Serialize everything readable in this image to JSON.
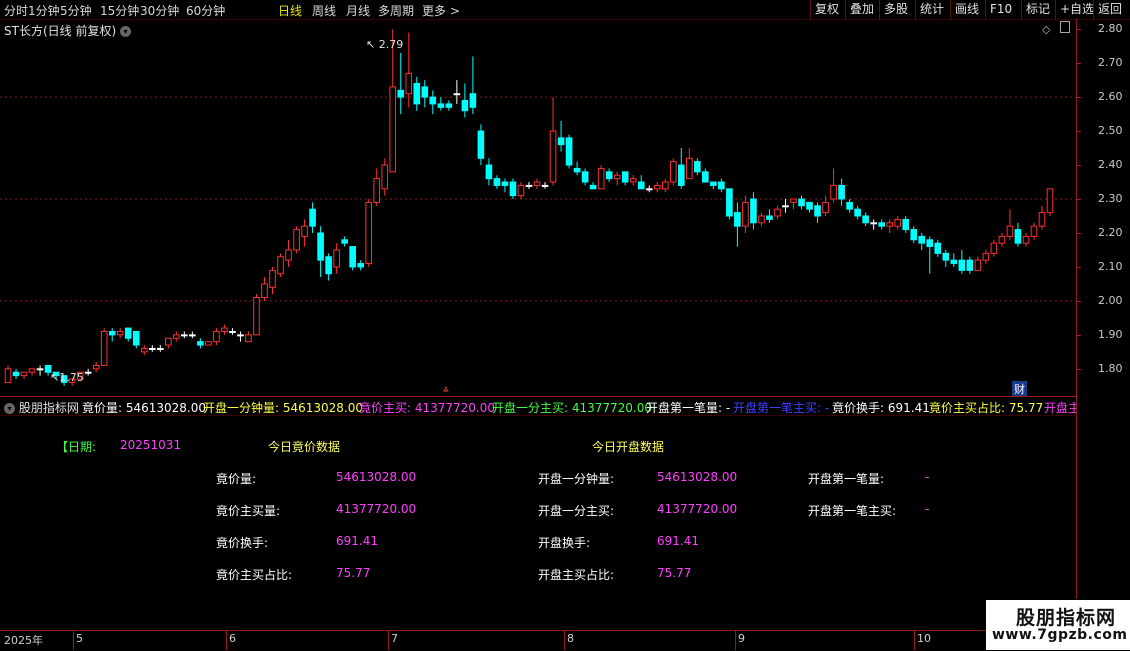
{
  "toolbar": {
    "periods": [
      {
        "label": "分时",
        "active": false
      },
      {
        "label": "1分钟",
        "active": false
      },
      {
        "label": "5分钟",
        "active": false
      },
      {
        "label": "15分钟",
        "active": false
      },
      {
        "label": "30分钟",
        "active": false
      },
      {
        "label": "60分钟",
        "active": false
      },
      {
        "label": "日线",
        "active": true
      },
      {
        "label": "周线",
        "active": false
      },
      {
        "label": "月线",
        "active": false
      },
      {
        "label": "多周期",
        "active": false
      },
      {
        "label": "更多 >",
        "active": false
      }
    ],
    "right_buttons": [
      "复权",
      "叠加",
      "多股",
      "统计",
      "画线",
      "F10",
      "标记",
      "+自选",
      "返回"
    ]
  },
  "chart": {
    "stock_title": "ST长方(日线 前复权)",
    "high_label": "2.79",
    "low_label": "1.75",
    "y_ticks": [
      "2.80",
      "2.70",
      "2.60",
      "2.50",
      "2.40",
      "2.30",
      "2.20",
      "2.10",
      "2.00",
      "1.90",
      "1.80"
    ],
    "fin_badge": "财",
    "colors": {
      "up": "#ff3030",
      "down": "#00ffff",
      "flat": "#ffffff",
      "grid": "#8b1a1a"
    }
  },
  "indicator_strip": {
    "name": "股朋指标网",
    "items": [
      {
        "text": "竟价量: 54613028.00",
        "color": "#ffffff"
      },
      {
        "text": "开盘一分钟量: 54613028.00",
        "color": "#ffff40"
      },
      {
        "text": "竟价主买: 41377720.00",
        "color": "#ff40ff"
      },
      {
        "text": "开盘一分主买: 41377720.00",
        "color": "#40ff40"
      },
      {
        "text": "开盘第一笔量: -",
        "color": "#ffffff"
      },
      {
        "text": "开盘第一笔主买: -",
        "color": "#4040ff"
      },
      {
        "text": "竟价换手: 691.41",
        "color": "#ffffff"
      },
      {
        "text": "竟价主买占比: 75.77",
        "color": "#ffff40"
      },
      {
        "text": "开盘主",
        "color": "#ff40ff"
      }
    ]
  },
  "table": {
    "date_label": "【日期:",
    "date_value": "20251031",
    "left_header": "今日竟价数据",
    "right_header": "今日开盘数据",
    "left_rows": [
      {
        "label": "竟价量:",
        "value": "54613028.00"
      },
      {
        "label": "竟价主买量:",
        "value": "41377720.00"
      },
      {
        "label": "竟价换手:",
        "value": "691.41"
      },
      {
        "label": "竟价主买占比:",
        "value": "75.77"
      }
    ],
    "mid_rows": [
      {
        "label": "开盘一分钟量:",
        "value": "54613028.00"
      },
      {
        "label": "开盘一分主买:",
        "value": "41377720.00"
      },
      {
        "label": "开盘换手:",
        "value": "691.41"
      },
      {
        "label": "开盘主买占比:",
        "value": "75.77"
      }
    ],
    "right_rows": [
      {
        "label": "开盘第一笔量:",
        "value": "-"
      },
      {
        "label": "开盘第一笔主买:",
        "value": "-"
      }
    ]
  },
  "date_axis": {
    "labels": [
      "2025年",
      "5",
      "6",
      "7",
      "8",
      "9",
      "10"
    ]
  },
  "watermark": {
    "title": "股朋指标网",
    "url": "www.7gpzb.com"
  },
  "chart_data": {
    "type": "candlestick",
    "y_range": [
      1.72,
      2.83
    ],
    "candles": [
      {
        "o": 1.76,
        "h": 1.81,
        "l": 1.76,
        "c": 1.8
      },
      {
        "o": 1.79,
        "h": 1.8,
        "l": 1.77,
        "c": 1.78
      },
      {
        "o": 1.78,
        "h": 1.79,
        "l": 1.77,
        "c": 1.79
      },
      {
        "o": 1.79,
        "h": 1.8,
        "l": 1.78,
        "c": 1.8
      },
      {
        "o": 1.8,
        "h": 1.81,
        "l": 1.78,
        "c": 1.8
      },
      {
        "o": 1.81,
        "h": 1.81,
        "l": 1.78,
        "c": 1.79
      },
      {
        "o": 1.79,
        "h": 1.79,
        "l": 1.77,
        "c": 1.78
      },
      {
        "o": 1.78,
        "h": 1.78,
        "l": 1.75,
        "c": 1.76
      },
      {
        "o": 1.76,
        "h": 1.77,
        "l": 1.75,
        "c": 1.77
      },
      {
        "o": 1.77,
        "h": 1.79,
        "l": 1.77,
        "c": 1.79
      },
      {
        "o": 1.79,
        "h": 1.8,
        "l": 1.78,
        "c": 1.79
      },
      {
        "o": 1.8,
        "h": 1.82,
        "l": 1.79,
        "c": 1.81
      },
      {
        "o": 1.81,
        "h": 1.92,
        "l": 1.81,
        "c": 1.91
      },
      {
        "o": 1.91,
        "h": 1.92,
        "l": 1.88,
        "c": 1.9
      },
      {
        "o": 1.9,
        "h": 1.92,
        "l": 1.89,
        "c": 1.91
      },
      {
        "o": 1.92,
        "h": 1.92,
        "l": 1.88,
        "c": 1.89
      },
      {
        "o": 1.91,
        "h": 1.91,
        "l": 1.86,
        "c": 1.87
      },
      {
        "o": 1.85,
        "h": 1.87,
        "l": 1.84,
        "c": 1.86
      },
      {
        "o": 1.86,
        "h": 1.87,
        "l": 1.85,
        "c": 1.86
      },
      {
        "o": 1.86,
        "h": 1.87,
        "l": 1.85,
        "c": 1.86
      },
      {
        "o": 1.87,
        "h": 1.89,
        "l": 1.86,
        "c": 1.89
      },
      {
        "o": 1.89,
        "h": 1.91,
        "l": 1.88,
        "c": 1.9
      },
      {
        "o": 1.9,
        "h": 1.91,
        "l": 1.89,
        "c": 1.9
      },
      {
        "o": 1.9,
        "h": 1.91,
        "l": 1.89,
        "c": 1.9
      },
      {
        "o": 1.88,
        "h": 1.89,
        "l": 1.86,
        "c": 1.87
      },
      {
        "o": 1.87,
        "h": 1.88,
        "l": 1.87,
        "c": 1.88
      },
      {
        "o": 1.88,
        "h": 1.92,
        "l": 1.87,
        "c": 1.91
      },
      {
        "o": 1.91,
        "h": 1.93,
        "l": 1.9,
        "c": 1.92
      },
      {
        "o": 1.91,
        "h": 1.92,
        "l": 1.9,
        "c": 1.91
      },
      {
        "o": 1.9,
        "h": 1.91,
        "l": 1.88,
        "c": 1.9
      },
      {
        "o": 1.88,
        "h": 1.91,
        "l": 1.88,
        "c": 1.9
      },
      {
        "o": 1.9,
        "h": 2.02,
        "l": 1.9,
        "c": 2.01
      },
      {
        "o": 2.01,
        "h": 2.07,
        "l": 2.0,
        "c": 2.05
      },
      {
        "o": 2.04,
        "h": 2.1,
        "l": 2.02,
        "c": 2.09
      },
      {
        "o": 2.08,
        "h": 2.14,
        "l": 2.07,
        "c": 2.13
      },
      {
        "o": 2.12,
        "h": 2.18,
        "l": 2.1,
        "c": 2.15
      },
      {
        "o": 2.15,
        "h": 2.22,
        "l": 2.14,
        "c": 2.21
      },
      {
        "o": 2.19,
        "h": 2.24,
        "l": 2.16,
        "c": 2.22
      },
      {
        "o": 2.27,
        "h": 2.29,
        "l": 2.2,
        "c": 2.22
      },
      {
        "o": 2.2,
        "h": 2.22,
        "l": 2.07,
        "c": 2.12
      },
      {
        "o": 2.13,
        "h": 2.14,
        "l": 2.06,
        "c": 2.08
      },
      {
        "o": 2.1,
        "h": 2.17,
        "l": 2.08,
        "c": 2.15
      },
      {
        "o": 2.18,
        "h": 2.19,
        "l": 2.16,
        "c": 2.17
      },
      {
        "o": 2.16,
        "h": 2.16,
        "l": 2.09,
        "c": 2.1
      },
      {
        "o": 2.11,
        "h": 2.12,
        "l": 2.09,
        "c": 2.1
      },
      {
        "o": 2.11,
        "h": 2.3,
        "l": 2.1,
        "c": 2.29
      },
      {
        "o": 2.29,
        "h": 2.39,
        "l": 2.28,
        "c": 2.36
      },
      {
        "o": 2.33,
        "h": 2.42,
        "l": 2.31,
        "c": 2.4
      },
      {
        "o": 2.38,
        "h": 2.8,
        "l": 2.38,
        "c": 2.63
      },
      {
        "o": 2.62,
        "h": 2.73,
        "l": 2.55,
        "c": 2.6
      },
      {
        "o": 2.61,
        "h": 2.79,
        "l": 2.57,
        "c": 2.67
      },
      {
        "o": 2.64,
        "h": 2.66,
        "l": 2.56,
        "c": 2.58
      },
      {
        "o": 2.63,
        "h": 2.65,
        "l": 2.57,
        "c": 2.6
      },
      {
        "o": 2.6,
        "h": 2.62,
        "l": 2.55,
        "c": 2.58
      },
      {
        "o": 2.58,
        "h": 2.6,
        "l": 2.56,
        "c": 2.57
      },
      {
        "o": 2.58,
        "h": 2.59,
        "l": 2.56,
        "c": 2.57
      },
      {
        "o": 2.61,
        "h": 2.65,
        "l": 2.58,
        "c": 2.61
      },
      {
        "o": 2.59,
        "h": 2.64,
        "l": 2.54,
        "c": 2.56
      },
      {
        "o": 2.61,
        "h": 2.72,
        "l": 2.55,
        "c": 2.57
      },
      {
        "o": 2.5,
        "h": 2.52,
        "l": 2.4,
        "c": 2.42
      },
      {
        "o": 2.4,
        "h": 2.42,
        "l": 2.34,
        "c": 2.36
      },
      {
        "o": 2.36,
        "h": 2.37,
        "l": 2.33,
        "c": 2.34
      },
      {
        "o": 2.35,
        "h": 2.36,
        "l": 2.32,
        "c": 2.34
      },
      {
        "o": 2.35,
        "h": 2.36,
        "l": 2.3,
        "c": 2.31
      },
      {
        "o": 2.31,
        "h": 2.35,
        "l": 2.3,
        "c": 2.34
      },
      {
        "o": 2.34,
        "h": 2.35,
        "l": 2.33,
        "c": 2.34
      },
      {
        "o": 2.34,
        "h": 2.36,
        "l": 2.33,
        "c": 2.35
      },
      {
        "o": 2.34,
        "h": 2.35,
        "l": 2.33,
        "c": 2.34
      },
      {
        "o": 2.35,
        "h": 2.6,
        "l": 2.34,
        "c": 2.5
      },
      {
        "o": 2.48,
        "h": 2.53,
        "l": 2.44,
        "c": 2.46
      },
      {
        "o": 2.48,
        "h": 2.49,
        "l": 2.39,
        "c": 2.4
      },
      {
        "o": 2.39,
        "h": 2.41,
        "l": 2.37,
        "c": 2.38
      },
      {
        "o": 2.38,
        "h": 2.39,
        "l": 2.34,
        "c": 2.35
      },
      {
        "o": 2.34,
        "h": 2.35,
        "l": 2.33,
        "c": 2.33
      },
      {
        "o": 2.33,
        "h": 2.4,
        "l": 2.33,
        "c": 2.39
      },
      {
        "o": 2.38,
        "h": 2.39,
        "l": 2.35,
        "c": 2.36
      },
      {
        "o": 2.36,
        "h": 2.38,
        "l": 2.34,
        "c": 2.37
      },
      {
        "o": 2.38,
        "h": 2.38,
        "l": 2.34,
        "c": 2.35
      },
      {
        "o": 2.35,
        "h": 2.37,
        "l": 2.34,
        "c": 2.36
      },
      {
        "o": 2.35,
        "h": 2.37,
        "l": 2.33,
        "c": 2.33
      },
      {
        "o": 2.33,
        "h": 2.34,
        "l": 2.32,
        "c": 2.33
      },
      {
        "o": 2.33,
        "h": 2.35,
        "l": 2.32,
        "c": 2.34
      },
      {
        "o": 2.33,
        "h": 2.36,
        "l": 2.32,
        "c": 2.35
      },
      {
        "o": 2.35,
        "h": 2.42,
        "l": 2.34,
        "c": 2.41
      },
      {
        "o": 2.4,
        "h": 2.45,
        "l": 2.33,
        "c": 2.34
      },
      {
        "o": 2.36,
        "h": 2.45,
        "l": 2.36,
        "c": 2.42
      },
      {
        "o": 2.41,
        "h": 2.42,
        "l": 2.37,
        "c": 2.38
      },
      {
        "o": 2.38,
        "h": 2.39,
        "l": 2.35,
        "c": 2.35
      },
      {
        "o": 2.35,
        "h": 2.35,
        "l": 2.33,
        "c": 2.34
      },
      {
        "o": 2.35,
        "h": 2.36,
        "l": 2.32,
        "c": 2.33
      },
      {
        "o": 2.33,
        "h": 2.33,
        "l": 2.24,
        "c": 2.25
      },
      {
        "o": 2.26,
        "h": 2.29,
        "l": 2.16,
        "c": 2.22
      },
      {
        "o": 2.22,
        "h": 2.31,
        "l": 2.2,
        "c": 2.29
      },
      {
        "o": 2.3,
        "h": 2.32,
        "l": 2.21,
        "c": 2.23
      },
      {
        "o": 2.23,
        "h": 2.26,
        "l": 2.22,
        "c": 2.25
      },
      {
        "o": 2.25,
        "h": 2.27,
        "l": 2.23,
        "c": 2.24
      },
      {
        "o": 2.25,
        "h": 2.28,
        "l": 2.24,
        "c": 2.27
      },
      {
        "o": 2.28,
        "h": 2.3,
        "l": 2.26,
        "c": 2.28
      },
      {
        "o": 2.29,
        "h": 2.3,
        "l": 2.27,
        "c": 2.3
      },
      {
        "o": 2.3,
        "h": 2.31,
        "l": 2.27,
        "c": 2.28
      },
      {
        "o": 2.29,
        "h": 2.29,
        "l": 2.26,
        "c": 2.27
      },
      {
        "o": 2.28,
        "h": 2.29,
        "l": 2.23,
        "c": 2.25
      },
      {
        "o": 2.26,
        "h": 2.31,
        "l": 2.25,
        "c": 2.29
      },
      {
        "o": 2.3,
        "h": 2.39,
        "l": 2.29,
        "c": 2.34
      },
      {
        "o": 2.34,
        "h": 2.36,
        "l": 2.28,
        "c": 2.3
      },
      {
        "o": 2.29,
        "h": 2.3,
        "l": 2.26,
        "c": 2.27
      },
      {
        "o": 2.27,
        "h": 2.28,
        "l": 2.24,
        "c": 2.25
      },
      {
        "o": 2.25,
        "h": 2.26,
        "l": 2.22,
        "c": 2.23
      },
      {
        "o": 2.23,
        "h": 2.24,
        "l": 2.21,
        "c": 2.23
      },
      {
        "o": 2.23,
        "h": 2.24,
        "l": 2.21,
        "c": 2.22
      },
      {
        "o": 2.22,
        "h": 2.24,
        "l": 2.2,
        "c": 2.23
      },
      {
        "o": 2.22,
        "h": 2.25,
        "l": 2.21,
        "c": 2.24
      },
      {
        "o": 2.24,
        "h": 2.25,
        "l": 2.2,
        "c": 2.21
      },
      {
        "o": 2.21,
        "h": 2.22,
        "l": 2.17,
        "c": 2.18
      },
      {
        "o": 2.19,
        "h": 2.2,
        "l": 2.15,
        "c": 2.17
      },
      {
        "o": 2.18,
        "h": 2.19,
        "l": 2.08,
        "c": 2.16
      },
      {
        "o": 2.17,
        "h": 2.18,
        "l": 2.13,
        "c": 2.14
      },
      {
        "o": 2.14,
        "h": 2.15,
        "l": 2.1,
        "c": 2.12
      },
      {
        "o": 2.12,
        "h": 2.14,
        "l": 2.1,
        "c": 2.11
      },
      {
        "o": 2.12,
        "h": 2.15,
        "l": 2.08,
        "c": 2.09
      },
      {
        "o": 2.12,
        "h": 2.13,
        "l": 2.08,
        "c": 2.09
      },
      {
        "o": 2.09,
        "h": 2.13,
        "l": 2.09,
        "c": 2.12
      },
      {
        "o": 2.12,
        "h": 2.15,
        "l": 2.11,
        "c": 2.14
      },
      {
        "o": 2.14,
        "h": 2.18,
        "l": 2.13,
        "c": 2.17
      },
      {
        "o": 2.17,
        "h": 2.2,
        "l": 2.16,
        "c": 2.19
      },
      {
        "o": 2.19,
        "h": 2.27,
        "l": 2.18,
        "c": 2.22
      },
      {
        "o": 2.21,
        "h": 2.23,
        "l": 2.16,
        "c": 2.17
      },
      {
        "o": 2.17,
        "h": 2.2,
        "l": 2.16,
        "c": 2.19
      },
      {
        "o": 2.19,
        "h": 2.23,
        "l": 2.18,
        "c": 2.22
      },
      {
        "o": 2.22,
        "h": 2.28,
        "l": 2.21,
        "c": 2.26
      },
      {
        "o": 2.26,
        "h": 2.33,
        "l": 2.25,
        "c": 2.33
      }
    ]
  }
}
